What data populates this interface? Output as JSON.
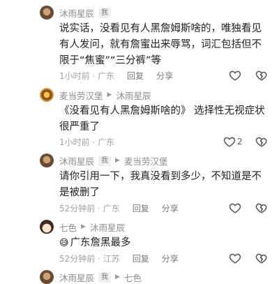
{
  "comments": [
    {
      "author": "沐雨星辰",
      "badge": "我",
      "text": "说实话，没看见有人黑詹姆斯啥的，唯独看见有人发问，就有詹蜜出来辱骂，词汇包括但不限于“焦蜜”“三分裤”等",
      "time": "1小时前",
      "location": "广东",
      "reply": "回复",
      "share": "分享"
    },
    {
      "author": "麦当劳汉堡",
      "reply_to": "沐雨星辰",
      "text": "《没看见有人黑詹姆斯啥的》 选择性无视症状很严重了",
      "time": "1小时前",
      "location": "广东",
      "likes": "2"
    },
    {
      "author": "沐雨星辰",
      "badge": "我",
      "reply_to": "麦当劳汉堡",
      "text": "请你引用一下，我真没看到多少，不知道是不是被删了",
      "time": "52分钟前",
      "location": "广东",
      "reply": "回复",
      "share": "分享"
    },
    {
      "author": "七色",
      "reply_to": "沐雨星辰",
      "emoji_name": "grinning-sweat-emoji",
      "text": "广东詹黑最多",
      "time": "52分钟前",
      "location": "江苏",
      "reply": "回复",
      "share": "分享"
    },
    {
      "author": "沐雨星辰",
      "badge": "我",
      "reply_to": "七色"
    }
  ],
  "separator": "·",
  "reply_arrow_icon": "triangle-right",
  "colors": {
    "name": "#8c8c8c",
    "meta": "#a2a2a2",
    "text": "#1f1f1f"
  }
}
